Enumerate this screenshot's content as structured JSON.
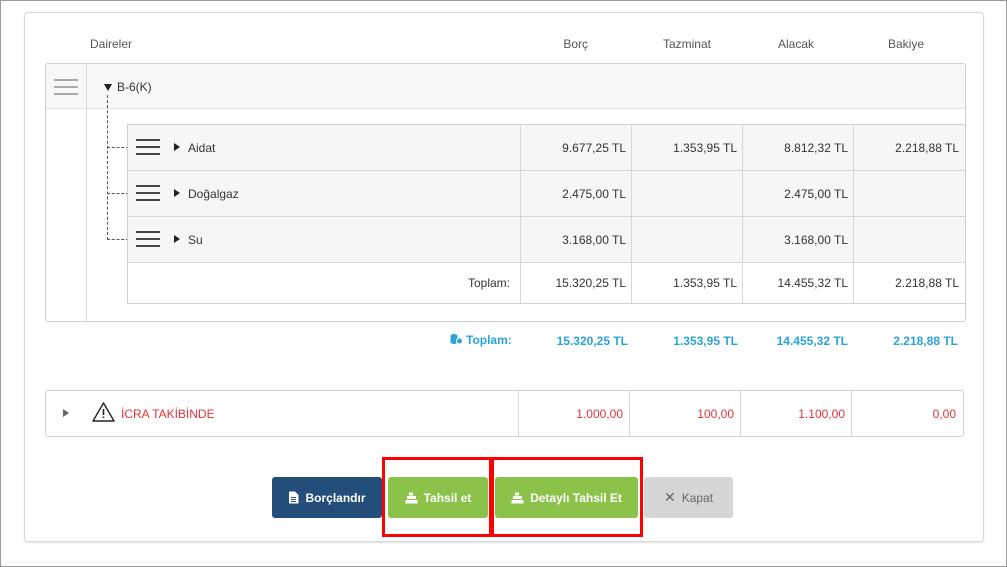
{
  "columns": {
    "daireler": "Daireler",
    "borc": "Borç",
    "tazminat": "Tazminat",
    "alacak": "Alacak",
    "bakiye": "Bakiye"
  },
  "tree": {
    "root_label": "B-6(K)",
    "rows": [
      {
        "label": "Aidat",
        "borc": "9.677,25 TL",
        "tazminat": "1.353,95 TL",
        "alacak": "8.812,32 TL",
        "bakiye": "2.218,88 TL"
      },
      {
        "label": "Doğalgaz",
        "borc": "2.475,00 TL",
        "tazminat": "",
        "alacak": "2.475,00 TL",
        "bakiye": ""
      },
      {
        "label": "Su",
        "borc": "3.168,00 TL",
        "tazminat": "",
        "alacak": "3.168,00 TL",
        "bakiye": ""
      }
    ],
    "subtotal": {
      "label": "Toplam:",
      "borc": "15.320,25 TL",
      "tazminat": "1.353,95 TL",
      "alacak": "14.455,32 TL",
      "bakiye": "2.218,88 TL"
    }
  },
  "grand_total": {
    "label": "Toplam:",
    "borc": "15.320,25 TL",
    "tazminat": "1.353,95 TL",
    "alacak": "14.455,32 TL",
    "bakiye": "2.218,88 TL"
  },
  "icra": {
    "label": "İCRA TAKİBİNDE",
    "borc": "1.000,00",
    "tazminat": "100,00",
    "alacak": "1.100,00",
    "bakiye": "0,00"
  },
  "buttons": {
    "borclandir": "Borçlandır",
    "tahsil_et": "Tahsil et",
    "detayli_tahsil_et": "Detaylı Tahsil Et",
    "kapat": "Kapat"
  },
  "colors": {
    "total_accent": "#2aa4d8",
    "icra_red": "#e0333a",
    "primary_blue": "#234e7a",
    "success_green": "#8bc34a",
    "highlight_red": "#ff0000"
  },
  "icons": {
    "money": "money-icon",
    "warning": "warning-icon",
    "document": "document-icon",
    "cash": "cash-register-icon",
    "close": "close-icon",
    "drag": "drag-handle-icon"
  }
}
